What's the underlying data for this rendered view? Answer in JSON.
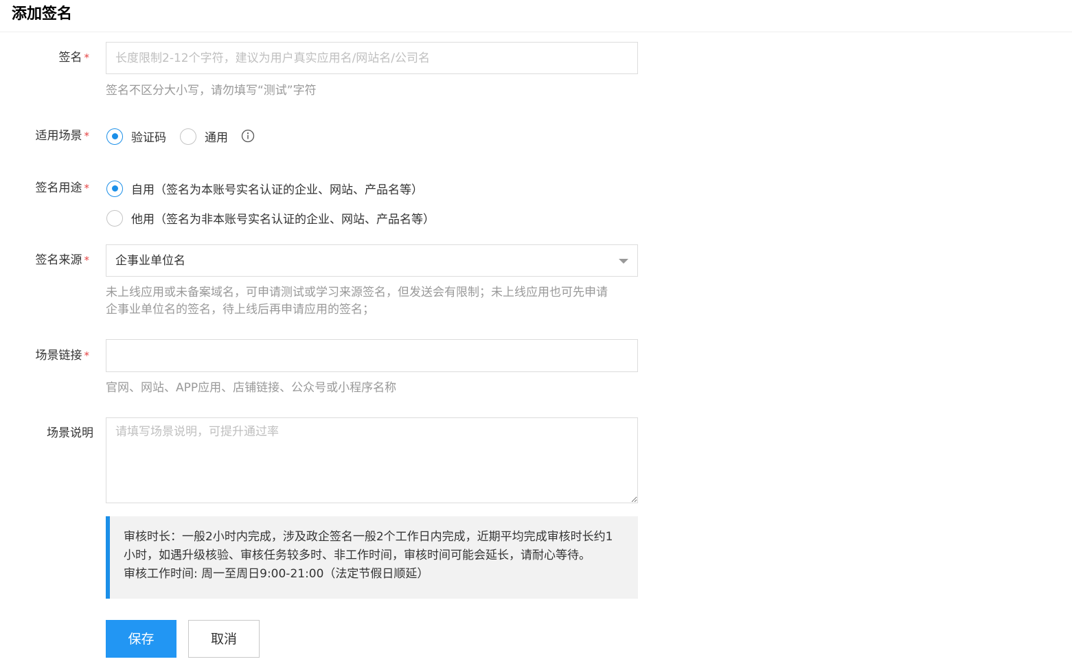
{
  "page": {
    "title": "添加签名"
  },
  "signature": {
    "label": "签名",
    "required_mark": "*",
    "placeholder": "长度限制2-12个字符，建议为用户真实应用名/网站名/公司名",
    "value": "",
    "hint": "签名不区分大小写，请勿填写“测试”字符"
  },
  "scene": {
    "label": "适用场景",
    "required_mark": "*",
    "options": [
      {
        "label": "验证码",
        "checked": true
      },
      {
        "label": "通用",
        "checked": false
      }
    ],
    "info_icon": "info-icon"
  },
  "usage": {
    "label": "签名用途",
    "required_mark": "*",
    "options": [
      {
        "label": "自用（签名为本账号实名认证的企业、网站、产品名等）",
        "checked": true
      },
      {
        "label": "他用（签名为非本账号实名认证的企业、网站、产品名等）",
        "checked": false
      }
    ]
  },
  "source": {
    "label": "签名来源",
    "required_mark": "*",
    "selected": "企事业单位名",
    "hint_line1": "未上线应用或未备案域名，可申请测试或学习来源签名，但发送会有限制；未上线应用也可先申请",
    "hint_line2": "企事业单位名的签名，待上线后再申请应用的签名；"
  },
  "scene_link": {
    "label": "场景链接",
    "required_mark": "*",
    "value": "",
    "placeholder": "",
    "hint": "官网、网站、APP应用、店铺链接、公众号或小程序名称"
  },
  "scene_desc": {
    "label": "场景说明",
    "placeholder": "请填写场景说明，可提升通过率",
    "value": ""
  },
  "notice": {
    "line1": "审核时长：一般2小时内完成，涉及政企签名一般2个工作日内完成，近期平均完成审核时长约1",
    "line2": "小时，如遇升级核验、审核任务较多时、非工作时间，审核时间可能会延长，请耐心等待。",
    "line3": "审核工作时间: 周一至周日9:00-21:00（法定节假日顺延）"
  },
  "actions": {
    "save": "保存",
    "cancel": "取消"
  },
  "colors": {
    "primary": "#1b8fe8",
    "required": "#e54545",
    "hint": "#999999"
  }
}
